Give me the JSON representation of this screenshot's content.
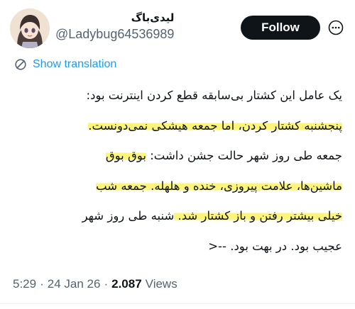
{
  "author": {
    "display_name": "لیدی‌باگ",
    "handle": "@Ladybug64536989"
  },
  "actions": {
    "follow_label": "Follow"
  },
  "translation": {
    "label": "Show translation"
  },
  "tweet": {
    "lines": [
      [
        {
          "text": "یک عامل این کشتار بی‌سابقه قطع کردن اینترنت بود:",
          "highlight": false
        }
      ],
      [
        {
          "text": "پنجشنبه کشتار کردن، اما جمعه هیشکی نمی‌دونست.",
          "highlight": true
        }
      ],
      [
        {
          "text": "جمعه طی روز شهر حالت جشن داشت: ",
          "highlight": false
        },
        {
          "text": "بوق بوق",
          "highlight": true
        }
      ],
      [
        {
          "text": "ماشین‌ها، علامت پیروزی، خنده و هلهله. جمعه شب",
          "highlight": true
        }
      ],
      [
        {
          "text": "خیلی بیشتر رفتن و باز کشتار شد. ",
          "highlight": true
        },
        {
          "text": "شنبه طی روز شهر",
          "highlight": false
        }
      ],
      [
        {
          "text": "عجیب بود. در بهت بود. --<",
          "highlight": false
        }
      ]
    ],
    "highlight_color": "#fcf57a"
  },
  "meta": {
    "time": "5:29",
    "date": "24 Jan 26",
    "views_count": "2.087",
    "views_label": "Views"
  },
  "colors": {
    "follow_button_bg": "#0f1419",
    "link": "#1d9bf0",
    "secondary_text": "#536471"
  },
  "icons": {
    "more": "more-icon",
    "translate": "translate-icon"
  }
}
